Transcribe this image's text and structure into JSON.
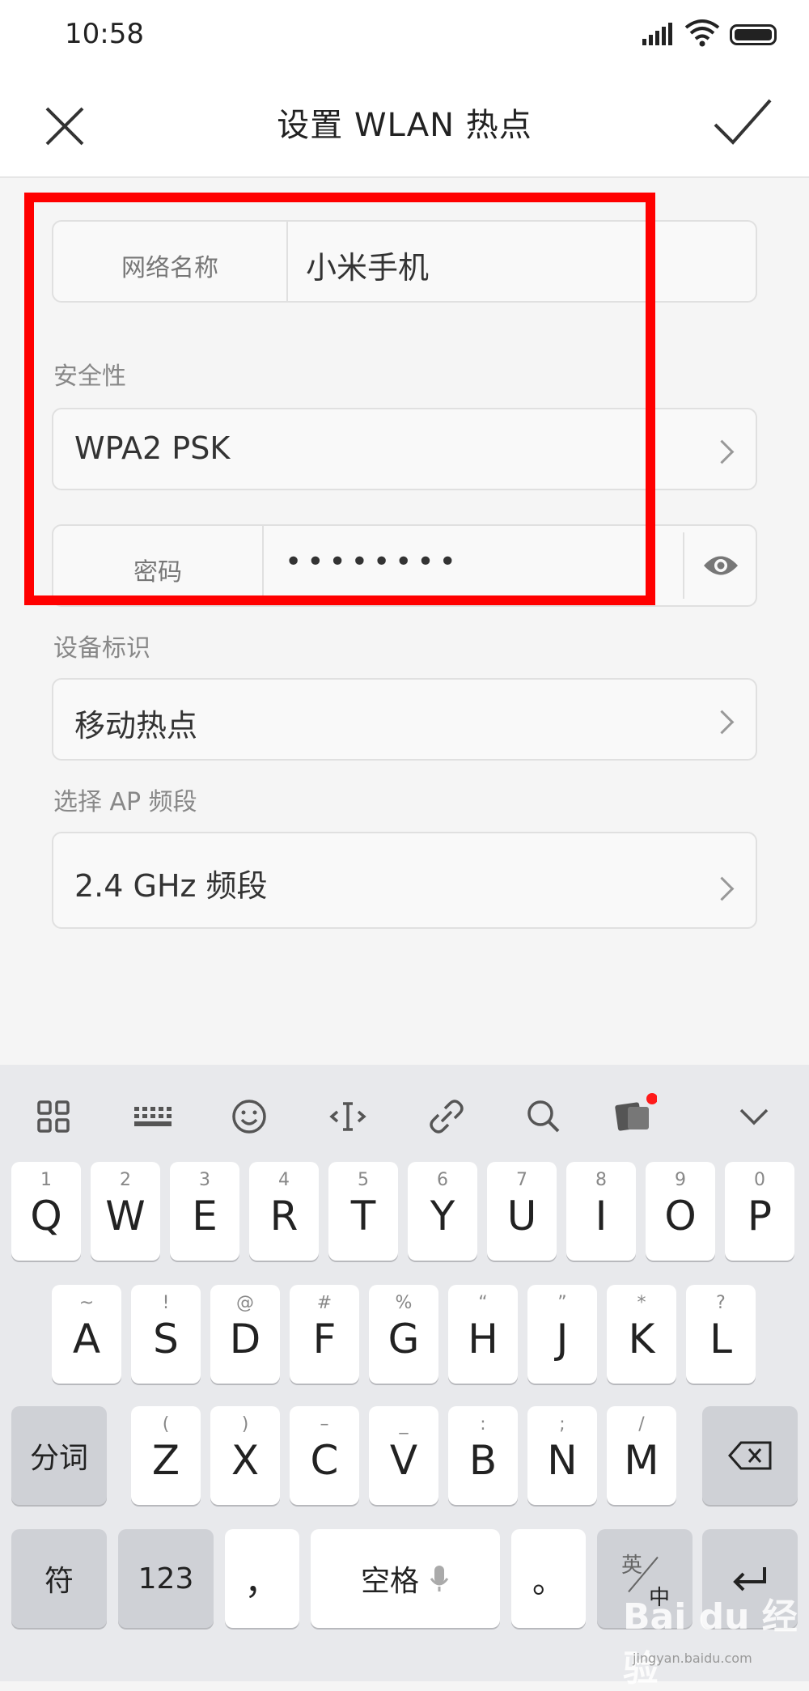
{
  "status_bar": {
    "time": "10:58"
  },
  "header": {
    "title": "设置 WLAN 热点"
  },
  "form": {
    "network_name_label": "网络名称",
    "network_name_value": "小米手机",
    "security_section": "安全性",
    "security_value": "WPA2 PSK",
    "password_label": "密码",
    "password_value": "••••••••",
    "device_id_section": "设备标识",
    "device_id_value": "移动热点",
    "ap_band_section": "选择 AP 频段",
    "ap_band_value": "2.4 GHz 频段"
  },
  "keyboard": {
    "toolbar_icons": [
      "grid-icon",
      "keyboard-icon",
      "emoji-icon",
      "cursor-icon",
      "clip-icon",
      "search-icon",
      "sticker-icon",
      "collapse-icon"
    ],
    "row1": [
      {
        "hint": "1",
        "key": "Q"
      },
      {
        "hint": "2",
        "key": "W"
      },
      {
        "hint": "3",
        "key": "E"
      },
      {
        "hint": "4",
        "key": "R"
      },
      {
        "hint": "5",
        "key": "T"
      },
      {
        "hint": "6",
        "key": "Y"
      },
      {
        "hint": "7",
        "key": "U"
      },
      {
        "hint": "8",
        "key": "I"
      },
      {
        "hint": "9",
        "key": "O"
      },
      {
        "hint": "0",
        "key": "P"
      }
    ],
    "row2": [
      {
        "hint": "~",
        "key": "A"
      },
      {
        "hint": "!",
        "key": "S"
      },
      {
        "hint": "@",
        "key": "D"
      },
      {
        "hint": "#",
        "key": "F"
      },
      {
        "hint": "%",
        "key": "G"
      },
      {
        "hint": "“",
        "key": "H"
      },
      {
        "hint": "”",
        "key": "J"
      },
      {
        "hint": "*",
        "key": "K"
      },
      {
        "hint": "?",
        "key": "L"
      }
    ],
    "row3": [
      {
        "hint": "(",
        "key": "Z"
      },
      {
        "hint": ")",
        "key": "X"
      },
      {
        "hint": "–",
        "key": "C"
      },
      {
        "hint": "_",
        "key": "V"
      },
      {
        "hint": ":",
        "key": "B"
      },
      {
        "hint": ";",
        "key": "N"
      },
      {
        "hint": "/",
        "key": "M"
      }
    ],
    "fenci": "分词",
    "fu": "符",
    "num": "123",
    "comma": "，",
    "space": "空格",
    "period": "。",
    "lang_top": "英",
    "lang_bottom": "中"
  },
  "watermark": {
    "main": "Bai du 经验",
    "sub": "jingyan.baidu.com"
  }
}
